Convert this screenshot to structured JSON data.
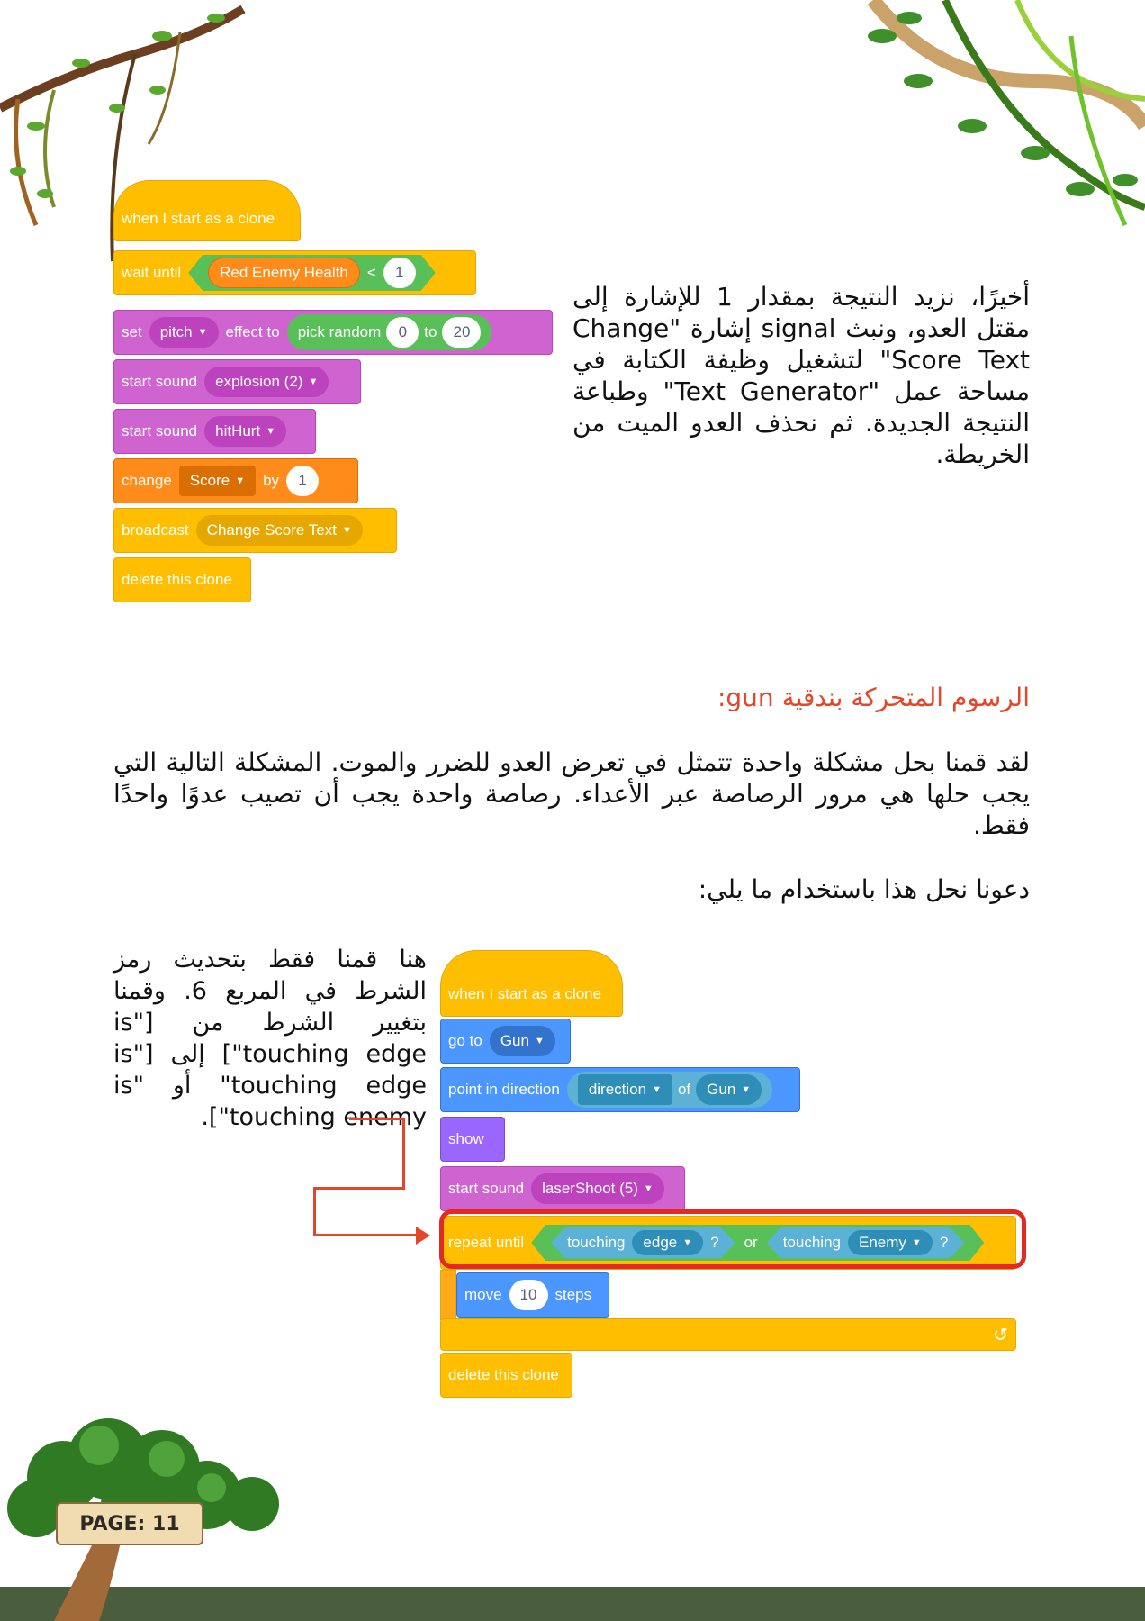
{
  "top_blocks": {
    "hat": "when I start as a clone",
    "wait_until": "wait until",
    "red_enemy_health": "Red Enemy Health",
    "less_than": "<",
    "wait_value": "1",
    "set": "set",
    "pitch": "pitch",
    "effect_to": "effect to",
    "pick_random": "pick random",
    "random_from": "0",
    "to": "to",
    "random_to": "20",
    "start_sound_1": "start sound",
    "sound_1": "explosion (2)",
    "start_sound_2": "start sound",
    "sound_2": "hitHurt",
    "change": "change",
    "score_var": "Score",
    "by": "by",
    "change_value": "1",
    "broadcast": "broadcast",
    "broadcast_msg": "Change Score Text",
    "delete_clone": "delete this clone"
  },
  "paragraph_1": "أخيرًا، نزيد النتيجة بمقدار 1 للإشارة إلى مقتل العدو، ونبث signal إشارة \"Change Score Text\" لتشغيل وظيفة الكتابة في مساحة عمل \"Text Generator\" وطباعة النتيجة الجديدة. ثم نحذف العدو الميت من الخريطة.",
  "heading": "الرسوم المتحركة بندقية gun:",
  "paragraph_2": "لقد قمنا بحل مشكلة واحدة تتمثل في تعرض العدو للضرر والموت. المشكلة التالية التي يجب حلها هي مرور الرصاصة عبر الأعداء. رصاصة واحدة يجب أن تصيب عدوًا واحدًا فقط.",
  "paragraph_3": "دعونا نحل هذا باستخدام ما يلي:",
  "paragraph_4": "هنا قمنا فقط بتحديث رمز الشرط في المربع 6. وقمنا بتغيير الشرط من [\"is touching edge\"] إلى [\"is touching edge\" أو \"is touching enemy\"].",
  "bottom_blocks": {
    "hat": "when I start as a clone",
    "go_to": "go to",
    "go_to_target": "Gun",
    "point_in_direction": "point in direction",
    "direction": "direction",
    "of": "of",
    "of_target": "Gun",
    "show": "show",
    "start_sound": "start sound",
    "sound": "laserShoot (5)",
    "repeat_until": "repeat until",
    "touching_1": "touching",
    "edge": "edge",
    "q1": "?",
    "or": "or",
    "touching_2": "touching",
    "enemy": "Enemy",
    "q2": "?",
    "move": "move",
    "move_value": "10",
    "steps": "steps",
    "loop_arrow": "↺",
    "delete_clone": "delete this clone"
  },
  "page_label": "PAGE: 11",
  "colors": {
    "accent": "#e4462a",
    "ground": "#4a5e3e",
    "foliage": "#3f8f2a"
  }
}
